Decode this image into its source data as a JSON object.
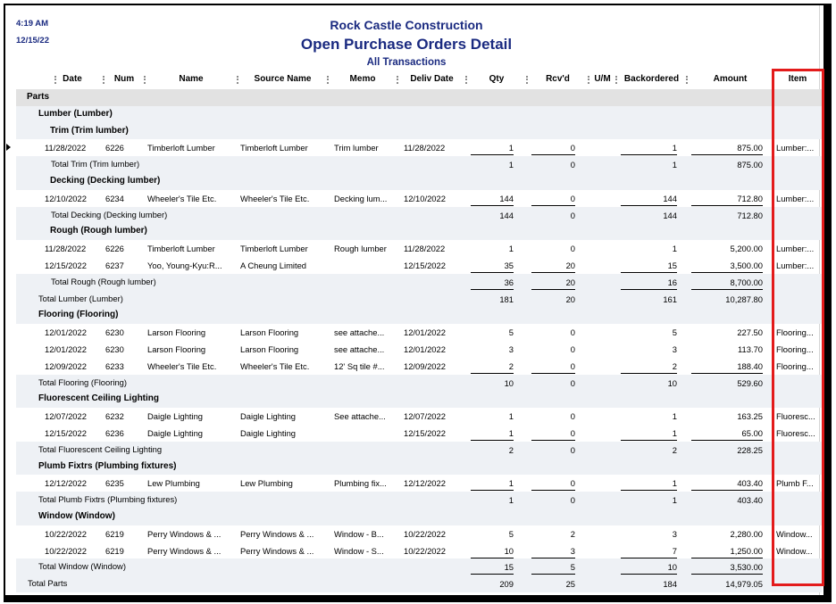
{
  "header": {
    "time": "4:19 AM",
    "date": "12/15/22",
    "company": "Rock Castle Construction",
    "title": "Open Purchase Orders Detail",
    "subtitle": "All Transactions"
  },
  "columns": {
    "date": "Date",
    "num": "Num",
    "name": "Name",
    "source_name": "Source Name",
    "memo": "Memo",
    "deliv_date": "Deliv Date",
    "qty": "Qty",
    "rcvd": "Rcv'd",
    "um": "U/M",
    "backordered": "Backordered",
    "amount": "Amount",
    "item": "Item"
  },
  "icons": {
    "current_row_marker": "row-pointer-icon"
  },
  "style": {
    "title_color": "#1a2a80",
    "section_bg": "#e2e2e2",
    "band_bg": "#eef1f5",
    "highlight_color": "#e31b1b"
  },
  "report": {
    "label": "Parts",
    "groups": [
      {
        "label": "Lumber (Lumber)",
        "subgroups": [
          {
            "label": "Trim (Trim lumber)",
            "lines": [
              {
                "date": "11/28/2022",
                "num": "6226",
                "name": "Timberloft Lumber",
                "source_name": "Timberloft Lumber",
                "memo": "Trim lumber",
                "deliv_date": "11/28/2022",
                "qty": "1",
                "rcvd": "0",
                "backordered": "1",
                "amount": "875.00",
                "item": "Lumber:...",
                "selected": true
              }
            ],
            "total": {
              "label": "Total Trim (Trim lumber)",
              "qty": "1",
              "rcvd": "0",
              "backordered": "1",
              "amount": "875.00"
            }
          },
          {
            "label": "Decking (Decking lumber)",
            "lines": [
              {
                "date": "12/10/2022",
                "num": "6234",
                "name": "Wheeler's Tile Etc.",
                "source_name": "Wheeler's Tile Etc.",
                "memo": "Decking lum...",
                "deliv_date": "12/10/2022",
                "qty": "144",
                "rcvd": "0",
                "backordered": "144",
                "amount": "712.80",
                "item": "Lumber:..."
              }
            ],
            "total": {
              "label": "Total Decking (Decking lumber)",
              "qty": "144",
              "rcvd": "0",
              "backordered": "144",
              "amount": "712.80"
            }
          },
          {
            "label": "Rough (Rough lumber)",
            "lines": [
              {
                "date": "11/28/2022",
                "num": "6226",
                "name": "Timberloft Lumber",
                "source_name": "Timberloft Lumber",
                "memo": "Rough lumber",
                "deliv_date": "11/28/2022",
                "qty": "1",
                "rcvd": "0",
                "backordered": "1",
                "amount": "5,200.00",
                "item": "Lumber:..."
              },
              {
                "date": "12/15/2022",
                "num": "6237",
                "name": "Yoo, Young-Kyu:R...",
                "source_name": "A Cheung Limited",
                "deliv_date": "12/15/2022",
                "qty": "35",
                "rcvd": "20",
                "backordered": "15",
                "amount": "3,500.00",
                "item": "Lumber:..."
              }
            ],
            "total": {
              "label": "Total Rough (Rough lumber)",
              "qty": "36",
              "rcvd": "20",
              "backordered": "16",
              "amount": "8,700.00"
            }
          }
        ],
        "total": {
          "label": "Total Lumber (Lumber)",
          "qty": "181",
          "rcvd": "20",
          "backordered": "161",
          "amount": "10,287.80"
        }
      },
      {
        "label": "Flooring (Flooring)",
        "lines": [
          {
            "date": "12/01/2022",
            "num": "6230",
            "name": "Larson Flooring",
            "source_name": "Larson Flooring",
            "memo": "see attache...",
            "deliv_date": "12/01/2022",
            "qty": "5",
            "rcvd": "0",
            "backordered": "5",
            "amount": "227.50",
            "item": "Flooring..."
          },
          {
            "date": "12/01/2022",
            "num": "6230",
            "name": "Larson Flooring",
            "source_name": "Larson Flooring",
            "memo": "see attache...",
            "deliv_date": "12/01/2022",
            "qty": "3",
            "rcvd": "0",
            "backordered": "3",
            "amount": "113.70",
            "item": "Flooring..."
          },
          {
            "date": "12/09/2022",
            "num": "6233",
            "name": "Wheeler's Tile Etc.",
            "source_name": "Wheeler's Tile Etc.",
            "memo": "12' Sq tile #...",
            "deliv_date": "12/09/2022",
            "qty": "2",
            "rcvd": "0",
            "backordered": "2",
            "amount": "188.40",
            "item": "Flooring..."
          }
        ],
        "total": {
          "label": "Total Flooring (Flooring)",
          "qty": "10",
          "rcvd": "0",
          "backordered": "10",
          "amount": "529.60"
        }
      },
      {
        "label": "Fluorescent Ceiling Lighting",
        "lines": [
          {
            "date": "12/07/2022",
            "num": "6232",
            "name": "Daigle Lighting",
            "source_name": "Daigle Lighting",
            "memo": "See attache...",
            "deliv_date": "12/07/2022",
            "qty": "1",
            "rcvd": "0",
            "backordered": "1",
            "amount": "163.25",
            "item": "Fluoresc..."
          },
          {
            "date": "12/15/2022",
            "num": "6236",
            "name": "Daigle Lighting",
            "source_name": "Daigle Lighting",
            "deliv_date": "12/15/2022",
            "qty": "1",
            "rcvd": "0",
            "backordered": "1",
            "amount": "65.00",
            "item": "Fluoresc..."
          }
        ],
        "total": {
          "label": "Total Fluorescent Ceiling Lighting",
          "qty": "2",
          "rcvd": "0",
          "backordered": "2",
          "amount": "228.25"
        }
      },
      {
        "label": "Plumb Fixtrs (Plumbing fixtures)",
        "lines": [
          {
            "date": "12/12/2022",
            "num": "6235",
            "name": "Lew Plumbing",
            "source_name": "Lew Plumbing",
            "memo": "Plumbing fix...",
            "deliv_date": "12/12/2022",
            "qty": "1",
            "rcvd": "0",
            "backordered": "1",
            "amount": "403.40",
            "item": "Plumb F..."
          }
        ],
        "total": {
          "label": "Total Plumb Fixtrs (Plumbing fixtures)",
          "qty": "1",
          "rcvd": "0",
          "backordered": "1",
          "amount": "403.40"
        }
      },
      {
        "label": "Window (Window)",
        "lines": [
          {
            "date": "10/22/2022",
            "num": "6219",
            "name": "Perry Windows & ...",
            "source_name": "Perry Windows & ...",
            "memo": "Window - B...",
            "deliv_date": "10/22/2022",
            "qty": "5",
            "rcvd": "2",
            "backordered": "3",
            "amount": "2,280.00",
            "item": "Window..."
          },
          {
            "date": "10/22/2022",
            "num": "6219",
            "name": "Perry Windows & ...",
            "source_name": "Perry Windows & ...",
            "memo": "Window - S...",
            "deliv_date": "10/22/2022",
            "qty": "10",
            "rcvd": "3",
            "backordered": "7",
            "amount": "1,250.00",
            "item": "Window..."
          }
        ],
        "total": {
          "label": "Total Window (Window)",
          "qty": "15",
          "rcvd": "5",
          "backordered": "10",
          "amount": "3,530.00"
        }
      }
    ],
    "total": {
      "label": "Total Parts",
      "qty": "209",
      "rcvd": "25",
      "backordered": "184",
      "amount": "14,979.05"
    }
  }
}
